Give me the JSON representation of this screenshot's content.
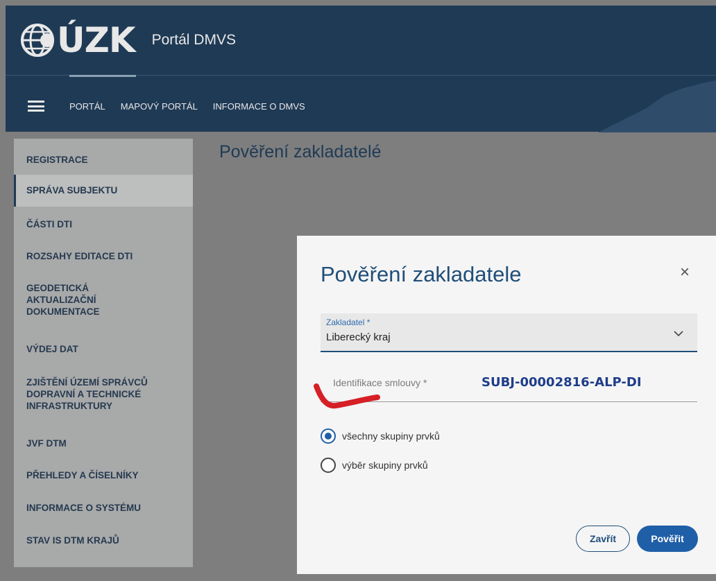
{
  "header": {
    "logo_text": "ÚZK",
    "logo_alt_text": "ČÚZK",
    "app_title": "Portál DMVS",
    "nav": [
      "PORTÁL",
      "MAPOVÝ PORTÁL",
      "INFORMACE O DMVS"
    ],
    "active_nav": "PORTÁL"
  },
  "sidebar": {
    "items": [
      {
        "label": "REGISTRACE"
      },
      {
        "label": "SPRÁVA SUBJEKTU",
        "active": true
      },
      {
        "label": "ČÁSTI DTI"
      },
      {
        "label": "ROZSAHY EDITACE DTI"
      },
      {
        "label": "GEODETICKÁ\nAKTUALIZAČNÍ\nDOKUMENTACE"
      },
      {
        "label": "VÝDEJ DAT"
      },
      {
        "label": "ZJIŠTĚNÍ ÚZEMÍ SPRÁVCŮ\nDOPRAVNÍ A TECHNICKÉ\nINFRASTRUKTURY"
      },
      {
        "label": "JVF DTM"
      },
      {
        "label": "PŘEHLEDY A ČÍSELNÍKY"
      },
      {
        "label": "INFORMACE O SYSTÉMU"
      },
      {
        "label": "STAV IS DTM KRAJŮ"
      }
    ]
  },
  "page": {
    "title": "Pověření zakladatelé"
  },
  "dialog": {
    "title": "Pověření zakladatele",
    "close_glyph": "×",
    "zakladatel_label": "Zakladatel *",
    "zakladatel_value": "Liberecký kraj",
    "identifikace_label": "Identifikace smlouvy *",
    "identifikace_value": "SUBJ-00002816-ALP-DI",
    "radio_options": [
      {
        "label": "všechny skupiny prvků",
        "checked": true
      },
      {
        "label": "výběr skupiny prvků",
        "checked": false
      }
    ],
    "btn_close": "Zavřít",
    "btn_confirm": "Pověřit"
  },
  "colors": {
    "header_bg": "#1f3a55",
    "accent_blue": "#1f5fa8",
    "annotation_red": "#d61f26"
  }
}
